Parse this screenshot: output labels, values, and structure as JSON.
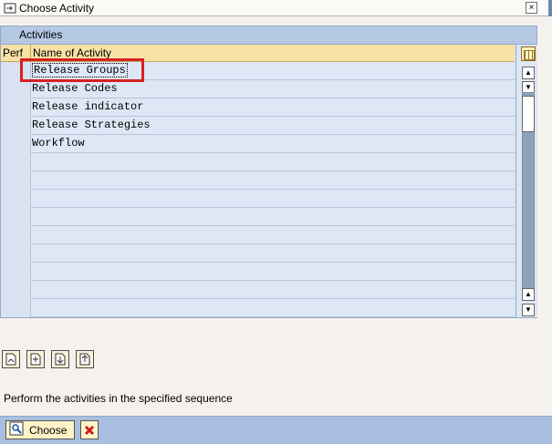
{
  "window": {
    "title": "Choose Activity",
    "close_glyph": "×"
  },
  "section": {
    "title": "Activities"
  },
  "table": {
    "columns": [
      "Perf",
      "Name of Activity"
    ],
    "rows": [
      {
        "perf": "",
        "name": "Release Groups"
      },
      {
        "perf": "",
        "name": "Release Codes"
      },
      {
        "perf": "",
        "name": "Release indicator"
      },
      {
        "perf": "",
        "name": "Release Strategies"
      },
      {
        "perf": "",
        "name": "Workflow"
      },
      {
        "perf": "",
        "name": ""
      },
      {
        "perf": "",
        "name": ""
      },
      {
        "perf": "",
        "name": ""
      },
      {
        "perf": "",
        "name": ""
      },
      {
        "perf": "",
        "name": ""
      },
      {
        "perf": "",
        "name": ""
      },
      {
        "perf": "",
        "name": ""
      },
      {
        "perf": "",
        "name": ""
      },
      {
        "perf": "",
        "name": ""
      }
    ],
    "selected_row": 0
  },
  "toolbar_icons": [
    "expand-all-icon",
    "collapse-icon",
    "select-block-icon",
    "deselect-icon"
  ],
  "hint": "Perform the activities in the specified sequence",
  "footer": {
    "choose_label": "Choose",
    "cancel_icon": "cancel-icon"
  },
  "colors": {
    "highlight": "#d62020",
    "header_bg": "#f7e1a4",
    "grid_bg": "#dee7f5",
    "footer_bg": "#a9bfe0"
  }
}
